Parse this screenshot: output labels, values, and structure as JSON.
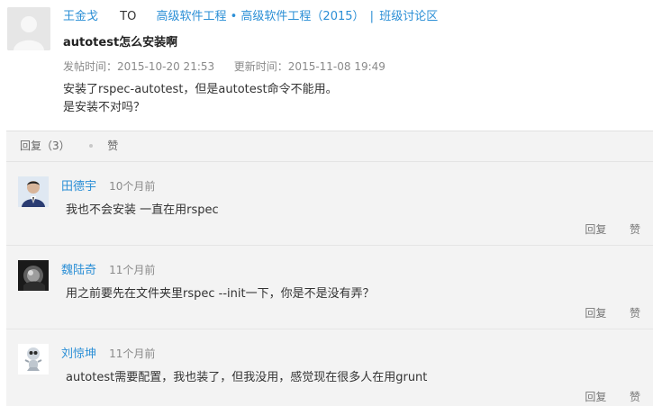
{
  "post": {
    "author": "王金戈",
    "to_label": "TO",
    "target_course": "高级软件工程 • 高级软件工程（2015）",
    "separator": "|",
    "target_board": "班级讨论区",
    "title": "autotest怎么安装啊",
    "posted_label": "发帖时间：2015-10-20 21:53",
    "updated_label": "更新时间：2015-11-08 19:49",
    "content_lines": [
      "安装了rspec-autotest，但是autotest命令不能用。",
      "是安装不对吗？"
    ]
  },
  "tabs": {
    "replies_label": "回复（3）",
    "like_label": "赞"
  },
  "replies": [
    {
      "name": "田德宇",
      "time": "10个月前",
      "text": "我也不会安装 一直在用rspec",
      "reply_label": "回复",
      "like_label": "赞",
      "avatar_icon": "person-photo-icon"
    },
    {
      "name": "魏陆奇",
      "time": "11个月前",
      "text": "用之前要先在文件夹里rspec --init一下，你是不是没有弄？",
      "reply_label": "回复",
      "like_label": "赞",
      "avatar_icon": "dark-photo-icon"
    },
    {
      "name": "刘惊坤",
      "time": "11个月前",
      "text": "autotest需要配置，我也装了，但我没用，感觉现在很多人在用grunt",
      "reply_label": "回复",
      "like_label": "赞",
      "avatar_icon": "robot-avatar-icon"
    }
  ]
}
